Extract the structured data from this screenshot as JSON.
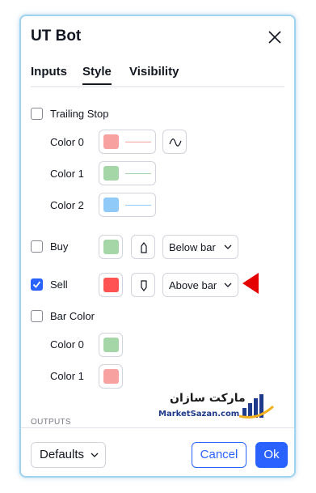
{
  "dialog": {
    "title": "UT Bot"
  },
  "tabs": [
    {
      "label": "Inputs",
      "active": false
    },
    {
      "label": "Style",
      "active": true
    },
    {
      "label": "Visibility",
      "active": false
    }
  ],
  "trailing_stop": {
    "label": "Trailing Stop",
    "checked": false,
    "colors": [
      {
        "label": "Color 0",
        "swatch": "#f7a1a1",
        "line": "#f7a1a1"
      },
      {
        "label": "Color 1",
        "swatch": "#a5d6a7",
        "line": "#a5d6a7"
      },
      {
        "label": "Color 2",
        "swatch": "#90caf9",
        "line": "#90caf9"
      }
    ]
  },
  "buy": {
    "label": "Buy",
    "checked": false,
    "swatch": "#a5d6a7",
    "location": "Below bar"
  },
  "sell": {
    "label": "Sell",
    "checked": true,
    "swatch": "#ff5252",
    "location": "Above bar"
  },
  "bar_color": {
    "label": "Bar Color",
    "checked": false,
    "colors": [
      {
        "label": "Color 0",
        "swatch": "#a5d6a7"
      },
      {
        "label": "Color 1",
        "swatch": "#f7a1a1"
      }
    ]
  },
  "outputs_header": "OUTPUTS",
  "footer": {
    "defaults_label": "Defaults",
    "cancel_label": "Cancel",
    "ok_label": "Ok"
  },
  "watermark": {
    "persian": "مارکت سازان",
    "english": "MarketSazan.com"
  },
  "accent_color": "#2962ff",
  "marker_color": "#e50000"
}
